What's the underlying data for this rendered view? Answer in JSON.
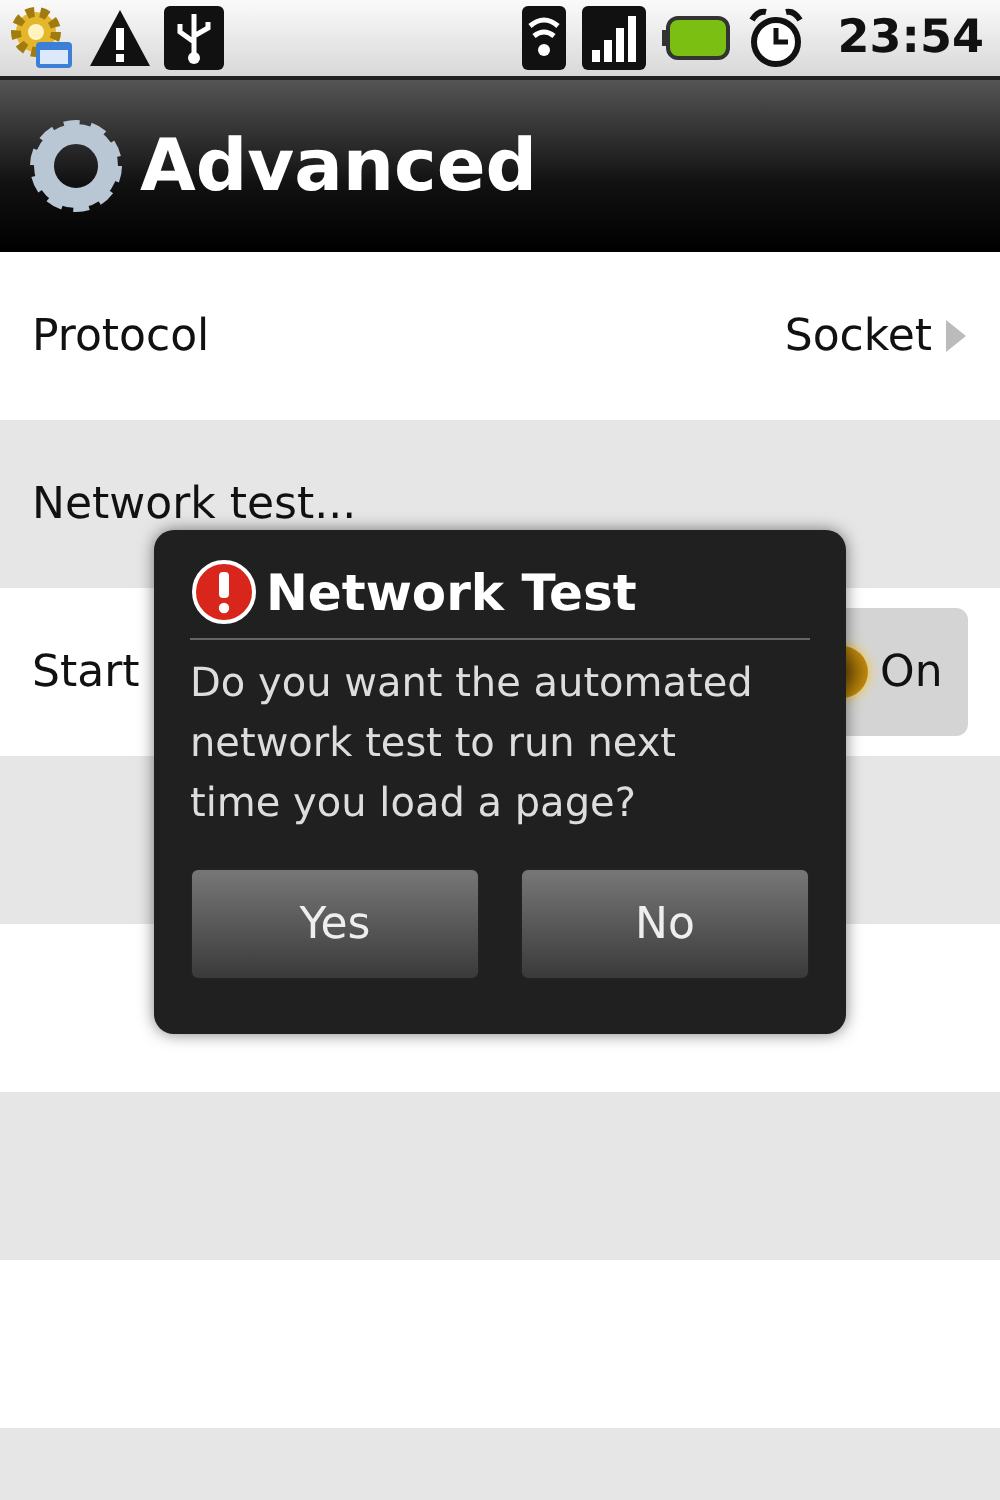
{
  "status_bar": {
    "time": "23:54"
  },
  "title_bar": {
    "title": "Advanced"
  },
  "settings": [
    {
      "kind": "link",
      "label": "Protocol",
      "value": "Socket"
    },
    {
      "kind": "action",
      "label": "Network test..."
    },
    {
      "kind": "toggle",
      "label": "Start",
      "state_label": "On",
      "on": true
    }
  ],
  "dialog": {
    "title": "Network Test",
    "message": "Do you want the automated network test to run next time you load a page?",
    "buttons": [
      "Yes",
      "No"
    ]
  }
}
